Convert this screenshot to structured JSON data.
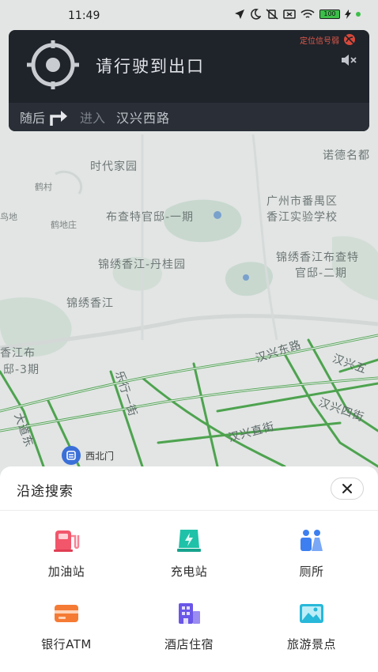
{
  "status_bar": {
    "time": "11:49",
    "battery": "100"
  },
  "navigation": {
    "instruction": "请行驶到出口",
    "gps_warning": "定位信号弱",
    "next_label": "随后",
    "enter_label": "进入",
    "road_name": "汉兴西路"
  },
  "map": {
    "labels": {
      "nuode": "诺德名都",
      "shidai": "时代家园",
      "hecun": "鹤村",
      "hedizhuang": "鹤地庄",
      "di": "鸟地",
      "buchate1": "布查特官邸-一期",
      "school1": "广州市番禺区",
      "school2": "香江实验学校",
      "danguiyuan": "锦绣香江-丹桂园",
      "buchate2a": "锦绣香江布查特",
      "buchate2b": "官邸-二期",
      "jinxiu": "锦绣香江",
      "xiang1": "香江布",
      "xiang2": "邸-3期",
      "hanxing_east": "汉兴东路",
      "hanxing_5": "汉兴五",
      "hanxing_4": "汉兴四街",
      "hanxing_zhi": "汉兴直街",
      "lexing": "乐行一街",
      "dadao": "大道东",
      "xibeimen": "西北门"
    }
  },
  "sheet": {
    "title": "沿途搜索",
    "items": [
      {
        "label": "加油站",
        "icon": "gas-station-icon",
        "color": "#f2566b"
      },
      {
        "label": "充电站",
        "icon": "charging-station-icon",
        "color": "#1fc2a8"
      },
      {
        "label": "厕所",
        "icon": "toilet-icon",
        "color": "#3d7ff0"
      },
      {
        "label": "银行ATM",
        "icon": "bank-card-icon",
        "color": "#f57b35"
      },
      {
        "label": "酒店住宿",
        "icon": "hotel-icon",
        "color": "#6a56e8"
      },
      {
        "label": "旅游景点",
        "icon": "scenery-icon",
        "color": "#28b8d9"
      }
    ]
  }
}
